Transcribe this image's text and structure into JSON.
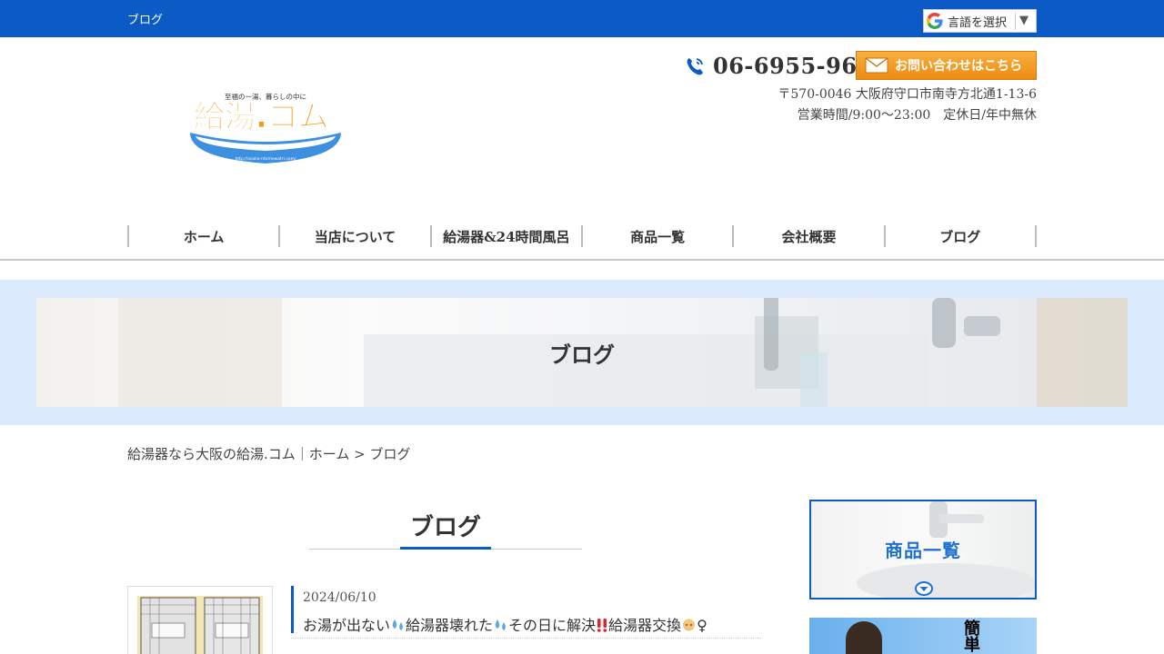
{
  "topbar": {
    "site_label": "ブログ",
    "language_select": "言語を選択",
    "language_arrow": "▼"
  },
  "header": {
    "logo": {
      "tagline": "至福の一湯、暮らしの中に",
      "name": "給湯.コム",
      "url": "http://osaka-ntomewatri.com/"
    },
    "phone": "06-6955-9618",
    "contact_button": "お問い合わせはこちら",
    "address": "〒570-0046 大阪府守口市南寺方北通1-13-6",
    "hours": "営業時間/9:00～23:00　定休日/年中無休"
  },
  "nav": [
    {
      "label": "ホーム"
    },
    {
      "label": "当店について"
    },
    {
      "label": "給湯器&24時間風呂"
    },
    {
      "label": "商品一覧"
    },
    {
      "label": "会社概要"
    },
    {
      "label": "ブログ"
    }
  ],
  "hero": {
    "title": "ブログ"
  },
  "breadcrumb": {
    "home": "給湯器なら大阪の給湯.コム｜ホーム",
    "separator": " > ",
    "current": "ブログ"
  },
  "main": {
    "section_title": "ブログ",
    "posts": [
      {
        "date": "2024/06/10",
        "title_parts": [
          "お湯が出ない",
          "給湯器壊れた",
          "その日に解決",
          "給湯器交換",
          "♀"
        ]
      }
    ]
  },
  "sidebar": {
    "banner1_label": "商品一覧",
    "banner2_label": "簡単"
  },
  "colors": {
    "brand_blue": "#0b5ac6",
    "hero_band": "#dbe9fd",
    "contact_orange": "#ee8c10"
  }
}
